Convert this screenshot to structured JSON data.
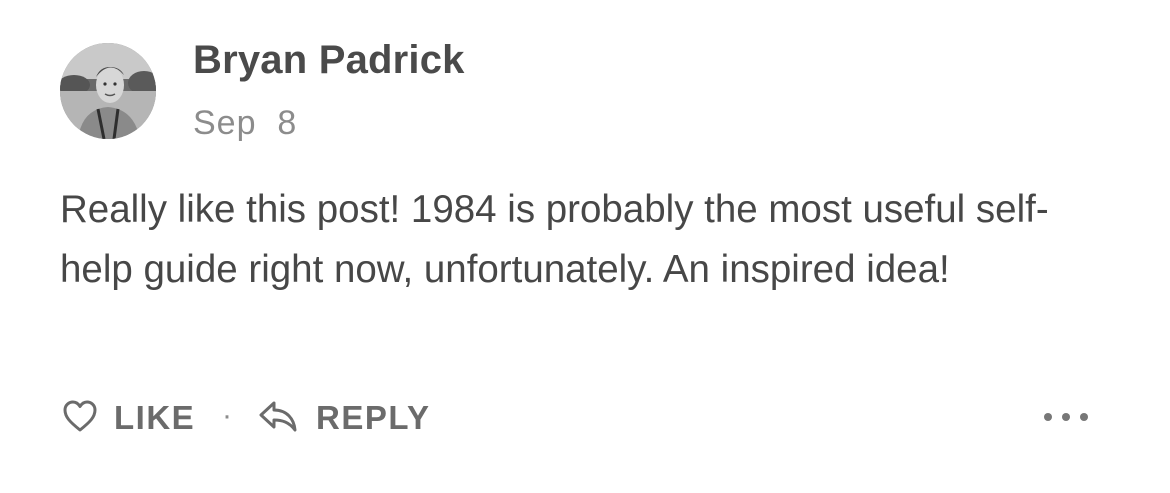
{
  "comment": {
    "author": "Bryan Padrick",
    "date": "Sep  8",
    "text": "Really like this post! 1984 is probably the most useful self-help guide right now, unfortunately. An inspired idea!",
    "avatar_icon": "user-avatar-photo"
  },
  "actions": {
    "like_label": "LIKE",
    "like_icon": "heart-outline-icon",
    "separator": "·",
    "reply_label": "REPLY",
    "reply_icon": "reply-arrow-icon",
    "more_icon": "more-horizontal-icon"
  },
  "colors": {
    "text": "#474747",
    "muted": "#8c8c8c",
    "action": "#6b6b6b"
  }
}
